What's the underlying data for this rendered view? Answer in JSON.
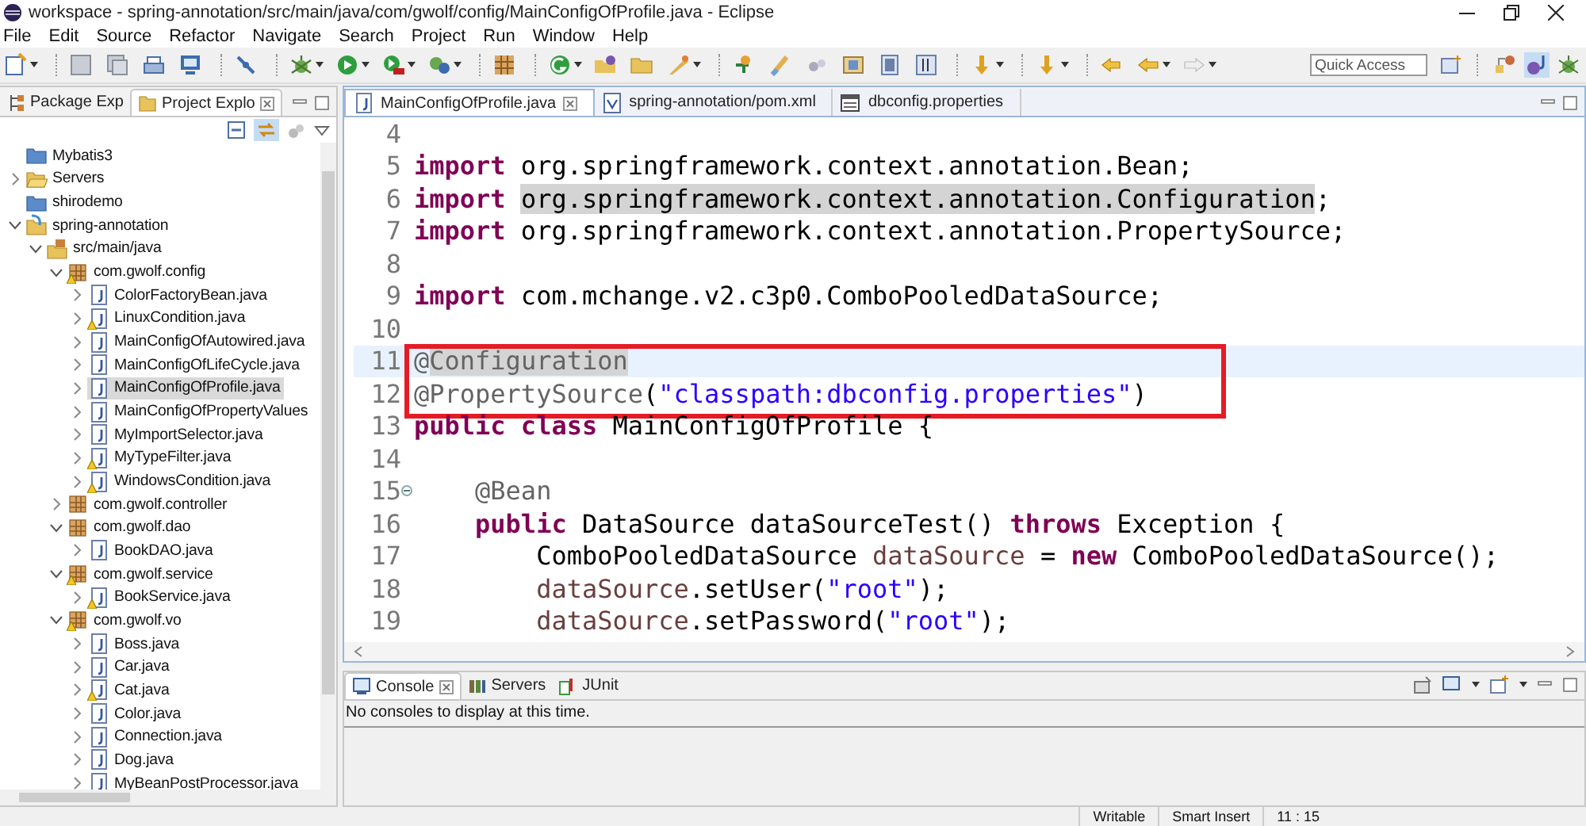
{
  "window": {
    "title": "workspace - spring-annotation/src/main/java/com/gwolf/config/MainConfigOfProfile.java - Eclipse"
  },
  "menu": [
    "File",
    "Edit",
    "Source",
    "Refactor",
    "Navigate",
    "Search",
    "Project",
    "Run",
    "Window",
    "Help"
  ],
  "quick_access": {
    "placeholder": "Quick Access"
  },
  "explorer": {
    "tabs": [
      {
        "label": "Package Exp",
        "kind": "package-explorer",
        "selected": false
      },
      {
        "label": "Project Explo",
        "kind": "project-explorer",
        "selected": true
      }
    ],
    "tree": [
      {
        "label": "Mybatis3",
        "kind": "closed-project",
        "selected": false,
        "warning": false
      },
      {
        "label": "Servers",
        "kind": "folder",
        "expanded": false,
        "selected": false,
        "warning": false
      },
      {
        "label": "shirodemo",
        "kind": "closed-project",
        "selected": false,
        "warning": false
      },
      {
        "label": "spring-annotation",
        "kind": "spring-project",
        "expanded": true,
        "selected": false,
        "warning": false,
        "children": [
          {
            "label": "src/main/java",
            "kind": "source-folder",
            "expanded": true,
            "selected": false,
            "warning": false,
            "children": [
              {
                "label": "com.gwolf.config",
                "kind": "package",
                "expanded": true,
                "selected": false,
                "warning": true,
                "children": [
                  {
                    "label": "ColorFactoryBean.java",
                    "kind": "java",
                    "expanded": false,
                    "selected": false,
                    "warning": false
                  },
                  {
                    "label": "LinuxCondition.java",
                    "kind": "java",
                    "expanded": false,
                    "selected": false,
                    "warning": true
                  },
                  {
                    "label": "MainConfigOfAutowired.java",
                    "kind": "java",
                    "expanded": false,
                    "selected": false,
                    "warning": false
                  },
                  {
                    "label": "MainConfigOfLifeCycle.java",
                    "kind": "java",
                    "expanded": false,
                    "selected": false,
                    "warning": false
                  },
                  {
                    "label": "MainConfigOfProfile.java",
                    "kind": "java",
                    "expanded": false,
                    "selected": true,
                    "warning": false
                  },
                  {
                    "label": "MainConfigOfPropertyValues",
                    "kind": "java",
                    "expanded": false,
                    "selected": false,
                    "warning": false
                  },
                  {
                    "label": "MyImportSelector.java",
                    "kind": "java",
                    "expanded": false,
                    "selected": false,
                    "warning": false
                  },
                  {
                    "label": "MyTypeFilter.java",
                    "kind": "java",
                    "expanded": false,
                    "selected": false,
                    "warning": true
                  },
                  {
                    "label": "WindowsCondition.java",
                    "kind": "java",
                    "expanded": false,
                    "selected": false,
                    "warning": true
                  }
                ]
              },
              {
                "label": "com.gwolf.controller",
                "kind": "package",
                "expanded": false,
                "selected": false,
                "warning": false
              },
              {
                "label": "com.gwolf.dao",
                "kind": "package",
                "expanded": true,
                "selected": false,
                "warning": false,
                "children": [
                  {
                    "label": "BookDAO.java",
                    "kind": "java",
                    "expanded": false,
                    "selected": false,
                    "warning": false
                  }
                ]
              },
              {
                "label": "com.gwolf.service",
                "kind": "package",
                "expanded": true,
                "selected": false,
                "warning": true,
                "children": [
                  {
                    "label": "BookService.java",
                    "kind": "java",
                    "expanded": false,
                    "selected": false,
                    "warning": true
                  }
                ]
              },
              {
                "label": "com.gwolf.vo",
                "kind": "package",
                "expanded": true,
                "selected": false,
                "warning": true,
                "children": [
                  {
                    "label": "Boss.java",
                    "kind": "java",
                    "expanded": false,
                    "selected": false,
                    "warning": false
                  },
                  {
                    "label": "Car.java",
                    "kind": "java",
                    "expanded": false,
                    "selected": false,
                    "warning": false
                  },
                  {
                    "label": "Cat.java",
                    "kind": "java",
                    "expanded": false,
                    "selected": false,
                    "warning": true
                  },
                  {
                    "label": "Color.java",
                    "kind": "java",
                    "expanded": false,
                    "selected": false,
                    "warning": false
                  },
                  {
                    "label": "Connection.java",
                    "kind": "java",
                    "expanded": false,
                    "selected": false,
                    "warning": false
                  },
                  {
                    "label": "Dog.java",
                    "kind": "java",
                    "expanded": false,
                    "selected": false,
                    "warning": false
                  },
                  {
                    "label": "MyBeanPostProcessor.java",
                    "kind": "java",
                    "expanded": false,
                    "selected": false,
                    "warning": false
                  }
                ]
              }
            ]
          }
        ]
      }
    ]
  },
  "editor": {
    "tabs": [
      {
        "label": "MainConfigOfProfile.java",
        "kind": "java",
        "selected": true
      },
      {
        "label": "spring-annotation/pom.xml",
        "kind": "xml",
        "selected": false
      },
      {
        "label": "dbconfig.properties",
        "kind": "properties",
        "selected": false
      }
    ],
    "lines": [
      {
        "number": "4",
        "current": false,
        "boxed": false,
        "foldable": false
      },
      {
        "number": "5",
        "current": false,
        "boxed": false,
        "foldable": false,
        "tokens": [
          {
            "text": "import",
            "kind": "keyword",
            "highlighted": false
          },
          {
            "text": " org.springframework.context.annotation.Bean;",
            "kind": "plain",
            "highlighted": false
          }
        ]
      },
      {
        "number": "6",
        "current": false,
        "boxed": false,
        "foldable": false,
        "tokens": [
          {
            "text": "import ",
            "kind": "keyword",
            "highlighted": false
          },
          {
            "text": "org.springframework.context.annotation.Configuration",
            "kind": "plain",
            "highlighted": true
          },
          {
            "text": ";",
            "kind": "plain",
            "highlighted": false
          }
        ]
      },
      {
        "number": "7",
        "current": false,
        "boxed": false,
        "foldable": false,
        "tokens": [
          {
            "text": "import",
            "kind": "keyword",
            "highlighted": false
          },
          {
            "text": " org.springframework.context.annotation.PropertySource;",
            "kind": "plain",
            "highlighted": false
          }
        ]
      },
      {
        "number": "8",
        "current": false,
        "boxed": false,
        "foldable": false
      },
      {
        "number": "9",
        "current": false,
        "boxed": false,
        "foldable": false,
        "tokens": [
          {
            "text": "import",
            "kind": "keyword",
            "highlighted": false
          },
          {
            "text": " com.mchange.v2.c3p0.ComboPooledDataSource;",
            "kind": "plain",
            "highlighted": false
          }
        ]
      },
      {
        "number": "10",
        "current": false,
        "boxed": false,
        "foldable": false
      },
      {
        "number": "11",
        "current": true,
        "boxed": true,
        "foldable": false,
        "tokens": [
          {
            "text": "@",
            "kind": "annotation",
            "highlighted": false
          },
          {
            "text": "Configuration",
            "kind": "annotation",
            "highlighted": true
          }
        ]
      },
      {
        "number": "12",
        "current": false,
        "boxed": true,
        "foldable": false,
        "tokens": [
          {
            "text": "@PropertySource",
            "kind": "annotation",
            "highlighted": false
          },
          {
            "text": "(",
            "kind": "plain",
            "highlighted": false
          },
          {
            "text": "\"classpath:dbconfig.properties\"",
            "kind": "string",
            "highlighted": false
          },
          {
            "text": ")",
            "kind": "plain",
            "highlighted": false
          }
        ]
      },
      {
        "number": "13",
        "current": false,
        "boxed": false,
        "foldable": false,
        "tokens": [
          {
            "text": "public class",
            "kind": "keyword",
            "highlighted": false
          },
          {
            "text": " MainConfigOfProfile {",
            "kind": "plain",
            "highlighted": false
          }
        ]
      },
      {
        "number": "14",
        "current": false,
        "boxed": false,
        "foldable": false
      },
      {
        "number": "15",
        "current": false,
        "boxed": false,
        "foldable": true,
        "tokens": [
          {
            "text": "    @Bean",
            "kind": "annotation",
            "highlighted": false
          }
        ]
      },
      {
        "number": "16",
        "current": false,
        "boxed": false,
        "foldable": false,
        "tokens": [
          {
            "text": "    public",
            "kind": "keyword",
            "highlighted": false
          },
          {
            "text": " DataSource dataSourceTest() ",
            "kind": "plain",
            "highlighted": false
          },
          {
            "text": "throws",
            "kind": "keyword",
            "highlighted": false
          },
          {
            "text": " Exception {",
            "kind": "plain",
            "highlighted": false
          }
        ]
      },
      {
        "number": "17",
        "current": false,
        "boxed": false,
        "foldable": false,
        "tokens": [
          {
            "text": "        ComboPooledDataSource ",
            "kind": "plain",
            "highlighted": false
          },
          {
            "text": "dataSource",
            "kind": "variable",
            "highlighted": false
          },
          {
            "text": " = ",
            "kind": "plain",
            "highlighted": false
          },
          {
            "text": "new",
            "kind": "keyword",
            "highlighted": false
          },
          {
            "text": " ComboPooledDataSource();",
            "kind": "plain",
            "highlighted": false
          }
        ]
      },
      {
        "number": "18",
        "current": false,
        "boxed": false,
        "foldable": false,
        "tokens": [
          {
            "text": "        dataSource",
            "kind": "variable",
            "highlighted": false
          },
          {
            "text": ".setUser(",
            "kind": "plain",
            "highlighted": false
          },
          {
            "text": "\"root\"",
            "kind": "string",
            "highlighted": false
          },
          {
            "text": ");",
            "kind": "plain",
            "highlighted": false
          }
        ]
      },
      {
        "number": "19",
        "current": false,
        "boxed": false,
        "foldable": false,
        "tokens": [
          {
            "text": "        dataSource",
            "kind": "variable",
            "highlighted": false
          },
          {
            "text": ".setPassword(",
            "kind": "plain",
            "highlighted": false
          },
          {
            "text": "\"root\"",
            "kind": "string",
            "highlighted": false
          },
          {
            "text": ");",
            "kind": "plain",
            "highlighted": false
          }
        ]
      }
    ]
  },
  "console": {
    "tabs": [
      {
        "label": "Console",
        "kind": "console",
        "selected": true
      },
      {
        "label": "Servers",
        "kind": "servers",
        "selected": false
      },
      {
        "label": "JUnit",
        "kind": "junit",
        "selected": false
      }
    ],
    "message": "No consoles to display at this time."
  },
  "status_bar": [
    "Writable",
    "Smart Insert",
    "11 : 15"
  ]
}
